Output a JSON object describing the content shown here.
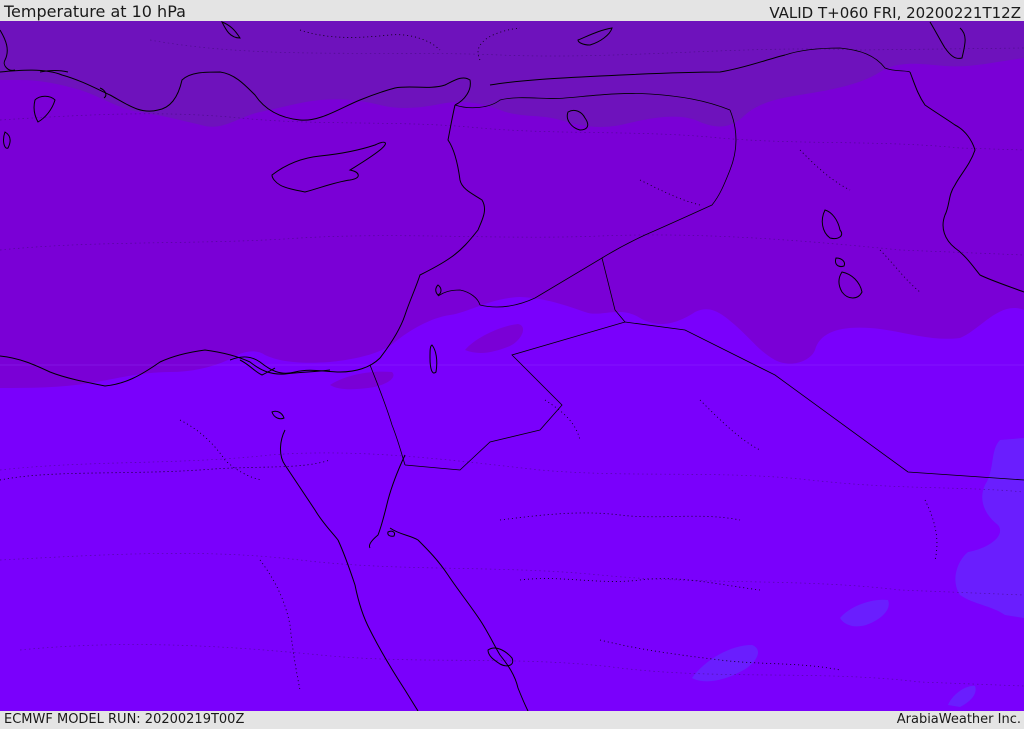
{
  "header": {
    "title": "Temperature at 10 hPa",
    "valid_time": "VALID T+060 FRI, 20200221T12Z"
  },
  "footer": {
    "model_run": "ECMWF MODEL RUN: 20200219T00Z",
    "credit": "ArabiaWeather Inc."
  },
  "colors": {
    "band_coldest": "#6e12bc",
    "band_cold": "#7a00d6",
    "band_mid": "#7a00fc",
    "band_warm": "#6a1efe",
    "border": "#000000",
    "header_background": "#e4e4e4"
  }
}
